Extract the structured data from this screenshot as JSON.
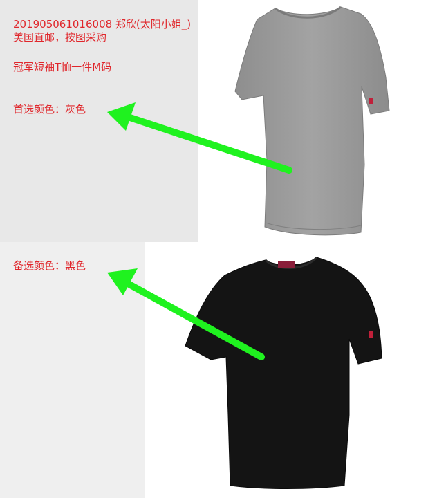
{
  "order": {
    "line1": "201905061016008   郑欣(太阳小姐_)",
    "line2": "美国直邮，按图采购",
    "product": "冠军短袖T恤一件M码",
    "preferred": "首选颜色：灰色",
    "alternate": "备选颜色：黑色"
  },
  "shirts": [
    {
      "name": "gray-tshirt",
      "color": "#9a9a9a"
    },
    {
      "name": "black-tshirt",
      "color": "#141414"
    }
  ],
  "arrow_color": "#1ff21f"
}
